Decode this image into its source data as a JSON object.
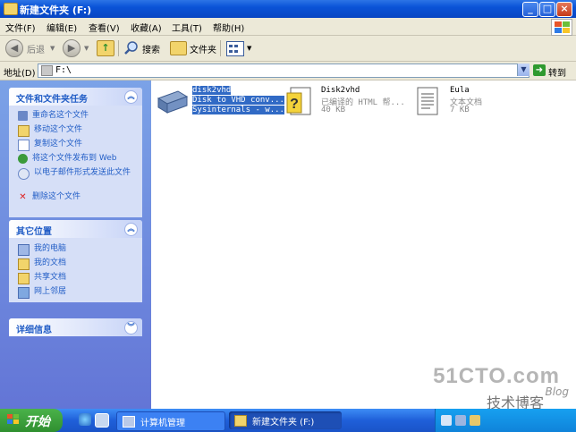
{
  "window": {
    "title": "新建文件夹 (F:)",
    "controls": {
      "minimize": "_",
      "maximize": "□",
      "close": "×"
    }
  },
  "menu": [
    "文件(F)",
    "编辑(E)",
    "查看(V)",
    "收藏(A)",
    "工具(T)",
    "帮助(H)"
  ],
  "toolbar": {
    "back": "后退",
    "search": "搜索",
    "folders": "文件夹"
  },
  "address": {
    "label": "地址(D)",
    "value": "F:\\",
    "go": "转到"
  },
  "panels": {
    "file_tasks": {
      "title": "文件和文件夹任务",
      "items": [
        {
          "label": "重命名这个文件",
          "icon": "rename-icon"
        },
        {
          "label": "移动这个文件",
          "icon": "move-icon"
        },
        {
          "label": "复制这个文件",
          "icon": "copy-icon"
        },
        {
          "label": "将这个文件发布到 Web",
          "icon": "web-publish-icon"
        },
        {
          "label": "以电子邮件形式发送此文件",
          "icon": "email-icon"
        },
        {
          "label": "删除这个文件",
          "icon": "delete-icon"
        }
      ]
    },
    "other_places": {
      "title": "其它位置",
      "items": [
        {
          "label": "我的电脑",
          "icon": "my-computer-icon"
        },
        {
          "label": "我的文档",
          "icon": "my-documents-icon"
        },
        {
          "label": "共享文档",
          "icon": "shared-documents-icon"
        },
        {
          "label": "网上邻居",
          "icon": "network-places-icon"
        }
      ]
    },
    "details": {
      "title": "详细信息"
    }
  },
  "files": [
    {
      "name": "disk2vhd",
      "desc": "Disk to VHD conv...",
      "extra": "Sysinternals - w...",
      "icon": "disk-drive-icon",
      "selected": true
    },
    {
      "name": "Disk2vhd",
      "desc": "已编译的 HTML 帮...",
      "extra": "40 KB",
      "icon": "help-file-icon",
      "selected": false
    },
    {
      "name": "Eula",
      "desc": "文本文档",
      "extra": "7 KB",
      "icon": "text-document-icon",
      "selected": false
    }
  ],
  "taskbar": {
    "start": "开始",
    "tasks": [
      "计算机管理",
      "新建文件夹 (F:)"
    ]
  },
  "watermark": {
    "site": "51CTO.com",
    "sub": "技术博客",
    "blog": "Blog"
  }
}
